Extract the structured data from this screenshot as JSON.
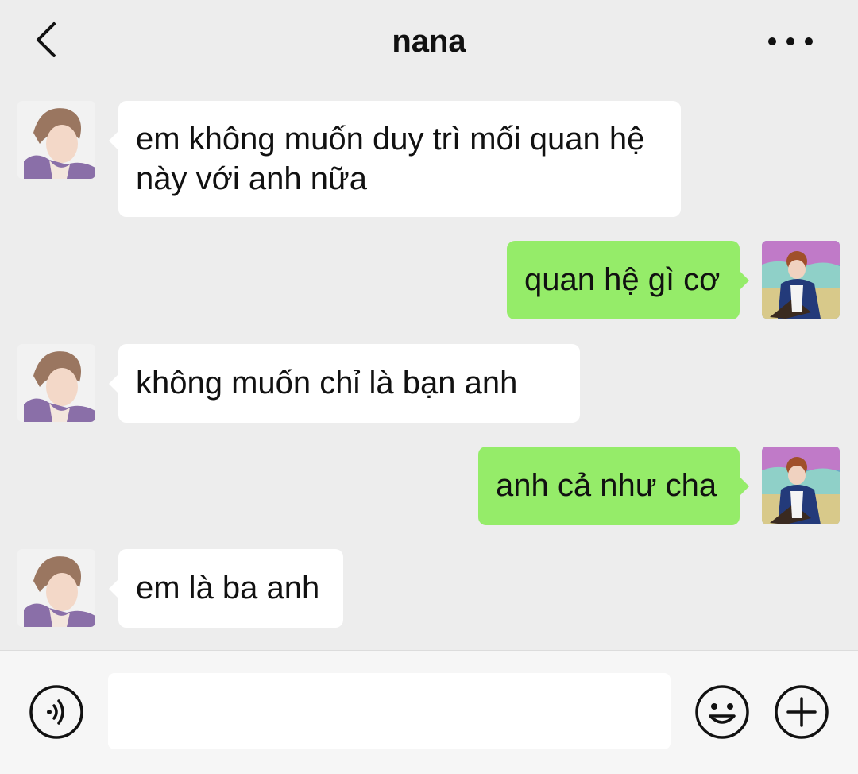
{
  "header": {
    "title": "nana",
    "back_icon": "chevron-left-icon",
    "more_icon": "more-horizontal-icon"
  },
  "colors": {
    "background": "#ededed",
    "incoming_bubble": "#ffffff",
    "outgoing_bubble": "#95ec69"
  },
  "messages": [
    {
      "direction": "incoming",
      "lines": [
        "em không muốn duy trì mối quan hệ",
        "này với anh nữa"
      ]
    },
    {
      "direction": "outgoing",
      "lines": [
        "quan hệ gì cơ"
      ]
    },
    {
      "direction": "incoming",
      "lines": [
        "không muốn chỉ là bạn anh"
      ]
    },
    {
      "direction": "outgoing",
      "lines": [
        "anh cả như cha"
      ]
    },
    {
      "direction": "incoming",
      "lines": [
        "em là ba anh"
      ]
    }
  ],
  "footer": {
    "voice_icon": "voice-icon",
    "input_value": "",
    "emoji_icon": "emoji-icon",
    "plus_icon": "plus-icon"
  }
}
